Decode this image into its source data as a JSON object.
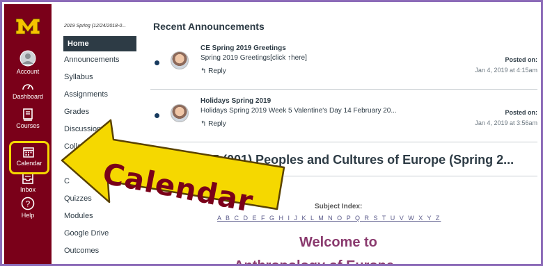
{
  "global_nav": {
    "items": [
      {
        "label": "Account",
        "icon": "account-icon"
      },
      {
        "label": "Dashboard",
        "icon": "dashboard-icon"
      },
      {
        "label": "Courses",
        "icon": "courses-icon"
      },
      {
        "label": "Calendar",
        "icon": "calendar-icon"
      },
      {
        "label": "Inbox",
        "icon": "inbox-icon"
      },
      {
        "label": "Help",
        "icon": "help-icon"
      }
    ],
    "brand_color": "#7a0019",
    "highlight_color": "#f5d800"
  },
  "course_nav": {
    "term": "2019 Spring (12/24/2018-0...",
    "items": [
      {
        "label": "Home"
      },
      {
        "label": "Announcements"
      },
      {
        "label": "Syllabus"
      },
      {
        "label": "Assignments"
      },
      {
        "label": "Grades"
      },
      {
        "label": "Discussions"
      },
      {
        "label": "Collaborations"
      },
      {
        "label": "C"
      },
      {
        "label": "Quizzes"
      },
      {
        "label": "Modules"
      },
      {
        "label": "Google Drive"
      },
      {
        "label": "Outcomes"
      }
    ],
    "active_item": "Home"
  },
  "main": {
    "recent_heading": "Recent Announcements",
    "announcements": [
      {
        "title": "CE Spring 2019 Greetings",
        "body": "Spring 2019 Greetings[click ↑here]",
        "reply": "Reply",
        "posted_label": "Posted on:",
        "posted_date": "Jan 4, 2019 at 4:15am"
      },
      {
        "title": "Holidays Spring 2019",
        "body": "Holidays Spring 2019 Week 5 Valentine's Day 14 February 20...",
        "reply": "Reply",
        "posted_label": "Posted on:",
        "posted_date": "Jan 4, 2019 at 3:56am"
      }
    ],
    "course_title": "ANTH 3635 (001) Peoples and Cultures of Europe (Spring 2...",
    "subject_index_label": "Subject Index:",
    "alphabet": "A B C D E F G H I J K L M N O P Q R S T U V W X Y Z",
    "welcome_line1": "Welcome to",
    "welcome_line2": "Anthropology of Europe"
  },
  "callout": {
    "text": "Calendar",
    "arrow_color": "#f5d800",
    "text_color": "#7a0019"
  }
}
